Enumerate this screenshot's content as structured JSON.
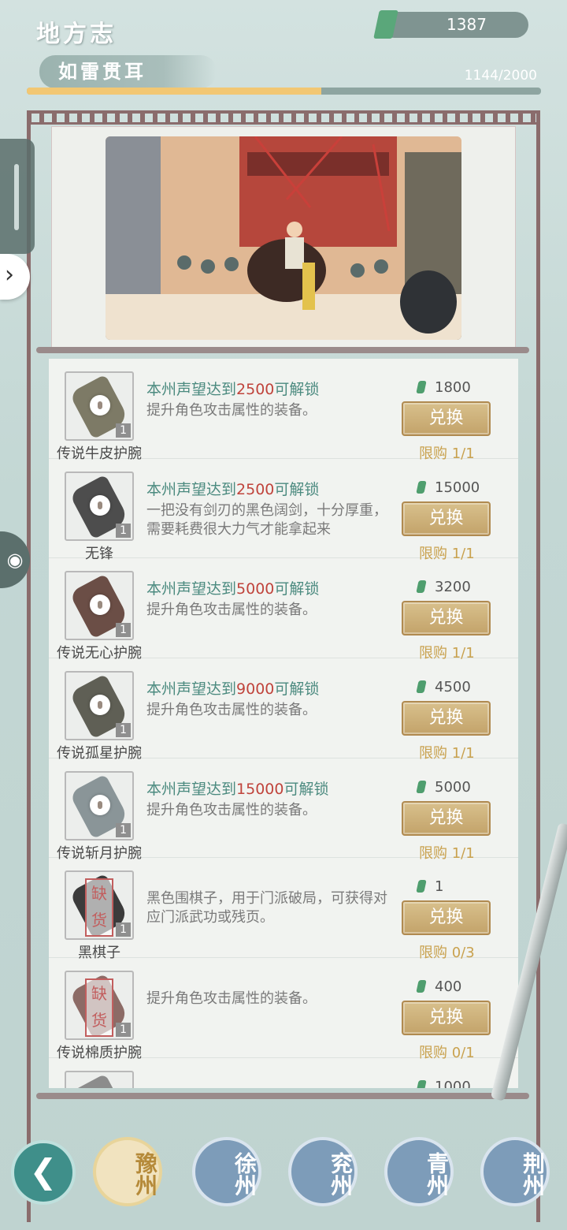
{
  "header": {
    "title": "地方志",
    "currency_value": "1387",
    "currency_icon": "jade-token-icon"
  },
  "reputation": {
    "title": "如雷贯耳",
    "progress_text": "1144/2000",
    "progress_fraction": 0.572
  },
  "banner": {
    "scene": "street-parade-illustration"
  },
  "exchange_label": "兑换",
  "items": [
    {
      "name": "传说牛皮护腕",
      "cond_pre": "本州声望达到",
      "cond_val": "2500",
      "cond_post": "可解锁",
      "desc": "提升角色攻击属性的装备。",
      "price": "1800",
      "limit": "限购 1/1",
      "qty": "1",
      "color": "#7d7a66",
      "locked": true
    },
    {
      "name": "无锋",
      "cond_pre": "本州声望达到",
      "cond_val": "2500",
      "cond_post": "可解锁",
      "desc": "一把没有剑刃的黑色阔剑，十分厚重，需要耗费很大力气才能拿起来",
      "price": "15000",
      "limit": "限购 1/1",
      "qty": "1",
      "color": "#4d4d4d",
      "locked": true
    },
    {
      "name": "传说无心护腕",
      "cond_pre": "本州声望达到",
      "cond_val": "5000",
      "cond_post": "可解锁",
      "desc": "提升角色攻击属性的装备。",
      "price": "3200",
      "limit": "限购 1/1",
      "qty": "1",
      "color": "#6b4e46",
      "locked": true
    },
    {
      "name": "传说孤星护腕",
      "cond_pre": "本州声望达到",
      "cond_val": "9000",
      "cond_post": "可解锁",
      "desc": "提升角色攻击属性的装备。",
      "price": "4500",
      "limit": "限购 1/1",
      "qty": "1",
      "color": "#5f5f55",
      "locked": true
    },
    {
      "name": "传说斩月护腕",
      "cond_pre": "本州声望达到",
      "cond_val": "15000",
      "cond_post": "可解锁",
      "desc": "提升角色攻击属性的装备。",
      "price": "5000",
      "limit": "限购 1/1",
      "qty": "1",
      "color": "#8a9598",
      "locked": true
    },
    {
      "name": "黑棋子",
      "cond_pre": "",
      "cond_val": "",
      "cond_post": "",
      "desc": "黑色围棋子，用于门派破局，可获得对应门派武功或残页。",
      "price": "1",
      "limit": "限购 0/3",
      "qty": "1",
      "color": "#3b3b3b",
      "locked": false,
      "stamp": "缺货"
    },
    {
      "name": "传说棉质护腕",
      "cond_pre": "",
      "cond_val": "",
      "cond_post": "",
      "desc": "提升角色攻击属性的装备。",
      "price": "400",
      "limit": "限购 0/1",
      "qty": "1",
      "color": "#8c6b66",
      "locked": false,
      "stamp": "缺货"
    },
    {
      "name": "",
      "cond_pre": "",
      "cond_val": "",
      "cond_post": "",
      "desc": "",
      "price": "1000",
      "limit": "",
      "qty": "",
      "color": "#8c8c8c",
      "locked": false
    }
  ],
  "tabs": [
    {
      "label": "豫州",
      "active": true
    },
    {
      "label": "徐州",
      "active": false
    },
    {
      "label": "兖州",
      "active": false
    },
    {
      "label": "青州",
      "active": false
    },
    {
      "label": "荆州",
      "active": false
    }
  ],
  "colors": {
    "accent_gold": "#c3a36a",
    "condition_text": "#4b8a7f",
    "highlight_red": "#c0443c",
    "limit_text": "#c9a24f"
  }
}
